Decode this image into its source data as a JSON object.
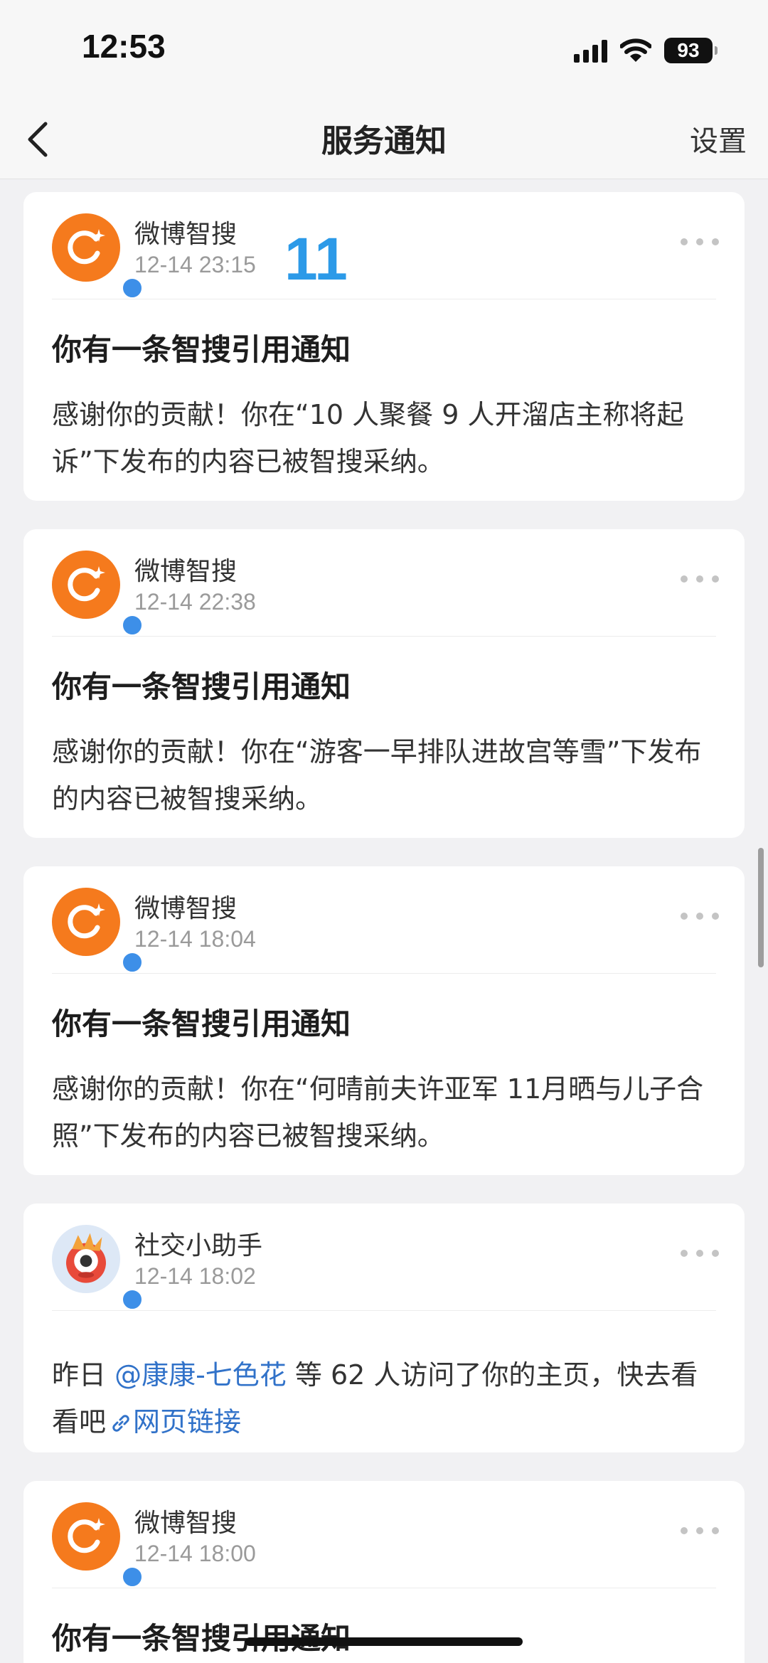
{
  "status_bar": {
    "time": "12:53",
    "battery": "93"
  },
  "nav": {
    "title": "服务通知",
    "right_label": "设置"
  },
  "overlay_number": "11",
  "notifications": [
    {
      "sender": "微博智搜",
      "time": "12-14 23:15",
      "title": "你有一条智搜引用通知",
      "body": "感谢你的贡献！你在“10 人聚餐 9 人开溜店主称将起诉”下发布的内容已被智搜采纳。"
    },
    {
      "sender": "微博智搜",
      "time": "12-14 22:38",
      "title": "你有一条智搜引用通知",
      "body": "感谢你的贡献！你在“游客一早排队进故宫等雪”下发布的内容已被智搜采纳。"
    },
    {
      "sender": "微博智搜",
      "time": "12-14 18:04",
      "title": "你有一条智搜引用通知",
      "body": "感谢你的贡献！你在“何晴前夫许亚军 11月晒与儿子合照”下发布的内容已被智搜采纳。"
    },
    {
      "sender": "社交小助手",
      "time": "12-14 18:02",
      "body_prefix": "昨日 ",
      "mention": "@康康-七色花",
      "body_suffix": " 等 62 人访问了你的主页，快去看看吧",
      "link_label": "网页链接"
    },
    {
      "sender": "微博智搜",
      "time": "12-14 18:00",
      "title": "你有一条智搜引用通知"
    }
  ],
  "icons": {
    "back": "chevron-left-icon",
    "more": "more-dots-icon",
    "verified": "verified-badge-icon",
    "link": "link-icon"
  },
  "colors": {
    "accent_link": "#3172c9",
    "avatar_orange": "#f57a1d",
    "verified_blue": "#3d8fe8",
    "overlay_number": "#2c9ae8"
  }
}
